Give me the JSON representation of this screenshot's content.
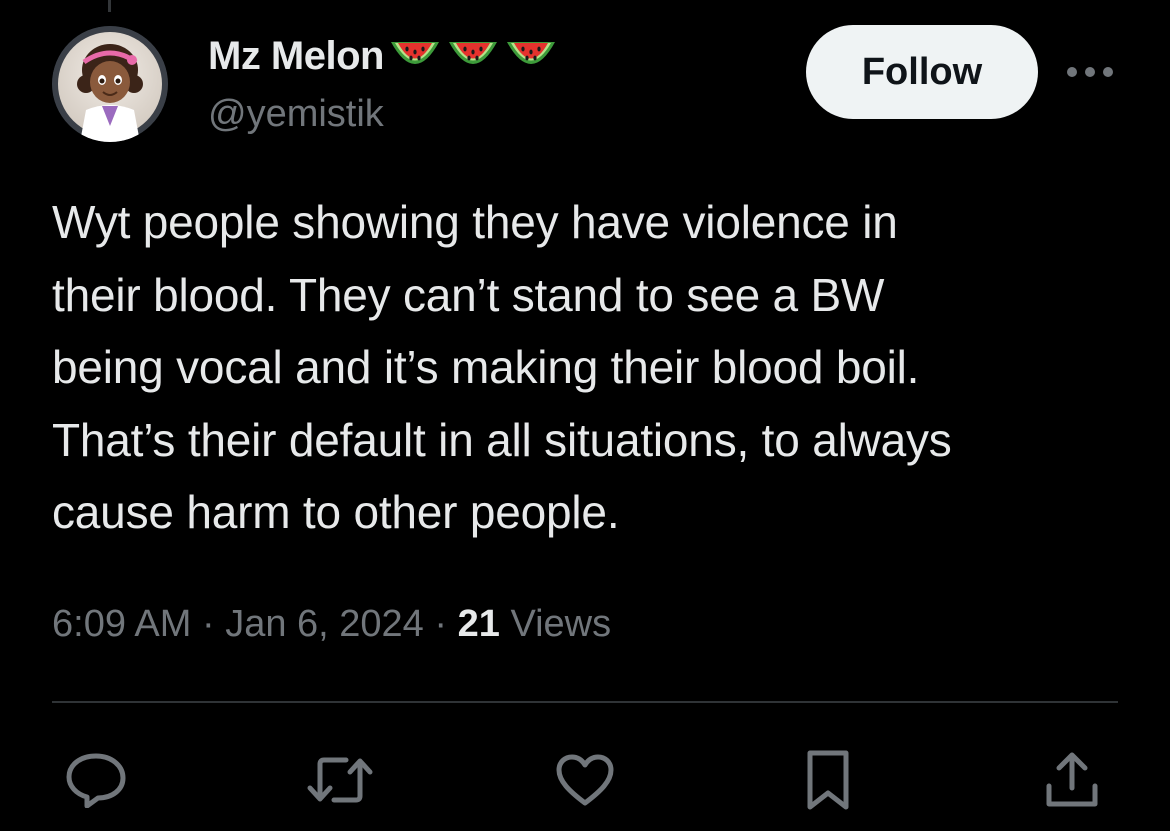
{
  "user": {
    "display_name": "Mz Melon",
    "name_emojis": [
      "watermelon-emoji",
      "watermelon-emoji",
      "watermelon-emoji"
    ],
    "handle": "@yemistik",
    "avatar": "cartoon-girl-doctor-avatar"
  },
  "header": {
    "follow_label": "Follow",
    "more_icon": "more-horizontal-icon"
  },
  "tweet": {
    "text": "Wyt people showing they have violence in\ntheir blood. They can’t stand to see a BW\nbeing vocal and it’s making their blood boil.\nThat’s their default in all situations, to always\ncause harm to other people."
  },
  "meta": {
    "time": "6:09 AM",
    "separator": "·",
    "date": "Jan 6, 2024",
    "views_count": "21",
    "views_label": "Views"
  },
  "actions": {
    "icons": [
      "reply-icon",
      "retweet-icon",
      "like-icon",
      "bookmark-icon",
      "share-icon"
    ]
  },
  "colors": {
    "background": "#000000",
    "primary_text": "#e7e9ea",
    "secondary_text": "#71767b",
    "divider": "#2f3336",
    "follow_bg": "#eff3f4",
    "follow_text": "#0f1419"
  }
}
